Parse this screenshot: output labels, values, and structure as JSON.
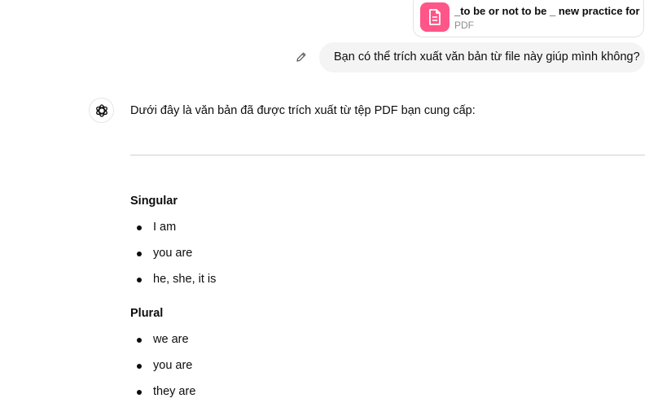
{
  "attachment": {
    "file_name": "_to be or not to be _ new practice for ...",
    "file_type": "PDF",
    "icon": "document-icon",
    "icon_bg": "#ff5588"
  },
  "user_message": {
    "text": "Bạn có thể trích xuất văn bản từ file này giúp mình không?",
    "edit_icon": "pencil-icon"
  },
  "assistant": {
    "avatar_icon": "openai-logo-icon",
    "intro": "Dưới đây là văn bản đã được trích xuất từ tệp PDF bạn cung cấp:",
    "sections": [
      {
        "heading": "Singular",
        "items": [
          "I am",
          "you are",
          "he, she, it is"
        ]
      },
      {
        "heading": "Plural",
        "items": [
          "we are",
          "you are",
          "they are"
        ]
      }
    ]
  }
}
